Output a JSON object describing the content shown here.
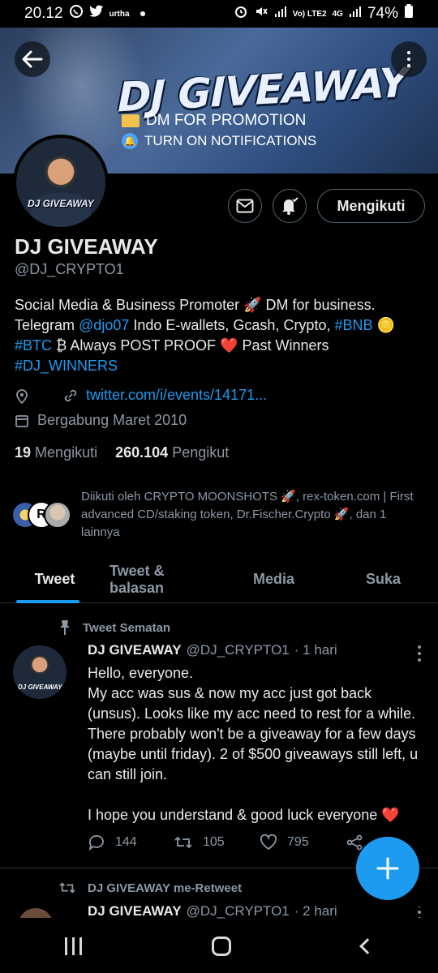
{
  "status_bar": {
    "time": "20.12",
    "carrier_icons": [
      "whatsapp-icon",
      "twitter-icon"
    ],
    "carrier_text": "urtha",
    "network": "Vo) LTE2",
    "network_type": "4G",
    "battery": "74%"
  },
  "banner": {
    "title": "DJ GIVEAWAY",
    "line1": "DM FOR PROMOTION",
    "line2": "TURN ON NOTIFICATIONS"
  },
  "avatar_tag": "DJ GIVEAWAY",
  "actions": {
    "follow_label": "Mengikuti"
  },
  "profile": {
    "name": "DJ GIVEAWAY",
    "handle": "@DJ_CRYPTO1",
    "bio": {
      "t1": "Social Media & Business Promoter 🚀 DM for business. Telegram ",
      "l1": "@djo07",
      "t2": " Indo E-wallets, Gcash, Crypto, ",
      "l2": "#BNB",
      "t3": " 🪙 ",
      "l3": "#BTC",
      "t4": " ₿  Always POST PROOF ❤️ Past Winners ",
      "l4": "#DJ_WINNERS"
    },
    "website": "twitter.com/i/events/14171...",
    "joined": "Bergabung Maret 2010",
    "following_count": "19",
    "following_label": "Mengikuti",
    "followers_count": "260.104",
    "followers_label": "Pengikut",
    "followed_by": "Diikuti oleh CRYPTO MOONSHOTS 🚀, rex-token.com | First advanced CD/staking token, Dr.Fischer.Crypto 🚀, dan 1 lainnya"
  },
  "tabs": [
    "Tweet",
    "Tweet & balasan",
    "Media",
    "Suka"
  ],
  "pinned_tweet": {
    "pin_label": "Tweet Sematan",
    "name": "DJ GIVEAWAY",
    "handle": "@DJ_CRYPTO1",
    "time": "· 1 hari",
    "body1": "Hello, everyone.",
    "body2": "My acc was sus & now my acc just got back (unsus). Looks like my acc need to rest for a while. There probably won't be a giveaway for a few days (maybe until friday). 2 of $500 giveaways still left, u can still join.",
    "body3": "I hope you understand & good luck everyone",
    "replies": "144",
    "retweets": "105",
    "likes": "795"
  },
  "retweet": {
    "label": "DJ GIVEAWAY me-Retweet",
    "name": "DJ GIVEAWAY",
    "handle": "@DJ_CRYPTO1",
    "time": "· 2 hari"
  },
  "colors": {
    "accent": "#1d9bf0",
    "background": "#000000",
    "text": "#e7e9ea",
    "muted": "#8b98a5",
    "heart": "#e0245e"
  }
}
